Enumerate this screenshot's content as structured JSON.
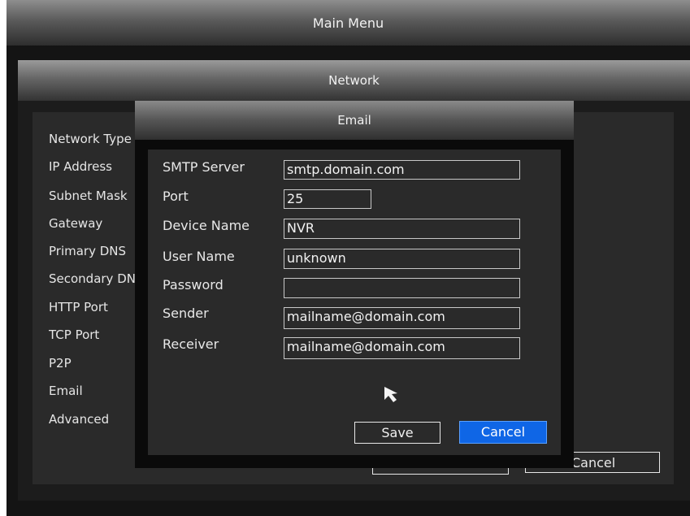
{
  "main_menu": {
    "title": "Main Menu"
  },
  "network": {
    "title": "Network",
    "items": [
      {
        "label": "Network Type"
      },
      {
        "label": "IP Address"
      },
      {
        "label": "Subnet Mask"
      },
      {
        "label": "Gateway"
      },
      {
        "label": "Primary DNS"
      },
      {
        "label": "Secondary DNS"
      },
      {
        "label": "HTTP Port"
      },
      {
        "label": "TCP Port"
      },
      {
        "label": "P2P"
      },
      {
        "label": "Email"
      },
      {
        "label": "Advanced"
      }
    ],
    "cancel_label": "Cancel"
  },
  "email": {
    "title": "Email",
    "fields": [
      {
        "label": "SMTP Server",
        "value": "smtp.domain.com"
      },
      {
        "label": "Port",
        "value": "25"
      },
      {
        "label": "Device Name",
        "value": "NVR"
      },
      {
        "label": "User Name",
        "value": "unknown"
      },
      {
        "label": "Password",
        "value": ""
      },
      {
        "label": "Sender",
        "value": "mailname@domain.com"
      },
      {
        "label": "Receiver",
        "value": "mailname@domain.com"
      }
    ],
    "save_label": "Save",
    "cancel_label": "Cancel"
  },
  "icons": {
    "cursor": "mouse-pointer-icon"
  },
  "colors": {
    "accent": "#0f66e6",
    "background": "#141414"
  }
}
